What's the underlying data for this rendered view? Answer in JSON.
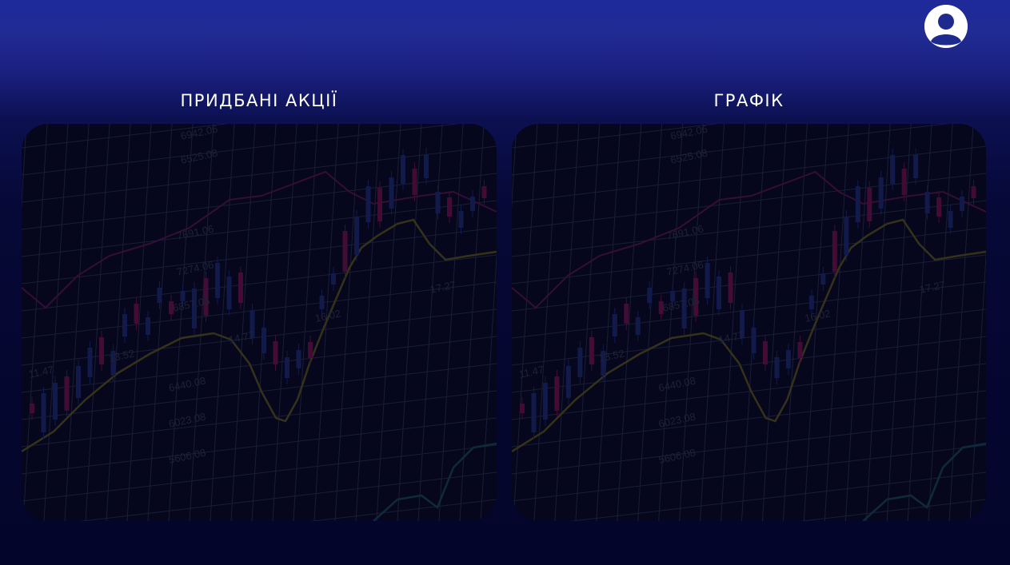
{
  "header": {
    "avatar_icon": "user-avatar-icon"
  },
  "panels": [
    {
      "title": "ПРИДБАНІ АКЦІЇ",
      "background": "stock-chart-image"
    },
    {
      "title": "ГРАФІК",
      "background": "stock-chart-image"
    }
  ],
  "chart_image_labels": [
    "6942.06",
    "6525.08",
    "7691.06",
    "7274.06",
    "6857.06",
    "6440.08",
    "6023.08",
    "5606.08",
    "17.27",
    "16.02",
    "14.77",
    "13.52",
    "11.47"
  ],
  "colors": {
    "background_top": "#1e2a9a",
    "background_bottom": "#04052a",
    "text": "#ffffff",
    "panel_bg": "#06061a",
    "candle_up": "#2a3f9e",
    "candle_down": "#b0175e",
    "line_yellow": "#8a8214",
    "line_magenta": "#8a1d6a"
  }
}
